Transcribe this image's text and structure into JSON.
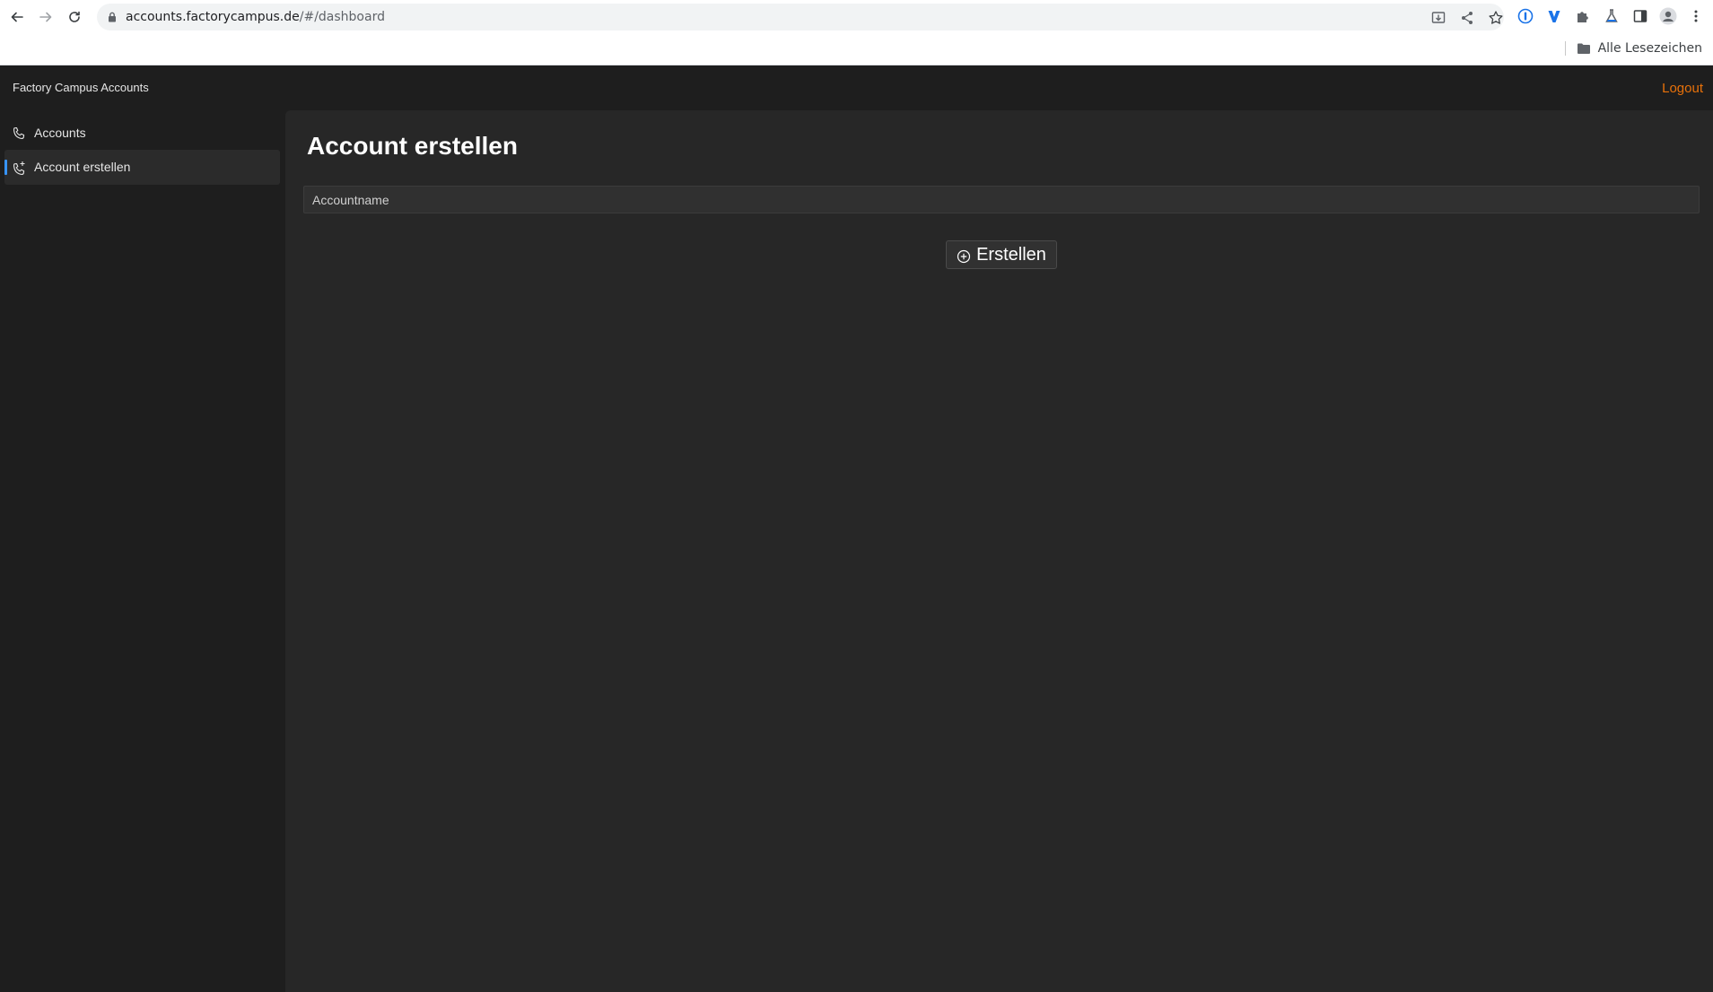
{
  "browser": {
    "url_host": "accounts.factorycampus.de",
    "url_rest": "/#/dashboard",
    "bookmarks_label": "Alle Lesezeichen"
  },
  "app": {
    "brand": "Factory Campus Accounts",
    "logout_label": "Logout",
    "accent_color": "#e8710a"
  },
  "sidebar": {
    "items": [
      {
        "label": "Accounts",
        "icon": "phone-icon",
        "active": false
      },
      {
        "label": "Account erstellen",
        "icon": "phone-add-icon",
        "active": true
      }
    ]
  },
  "main": {
    "title": "Account erstellen",
    "input": {
      "placeholder": "Accountname",
      "value": ""
    },
    "create_button_label": "Erstellen"
  }
}
